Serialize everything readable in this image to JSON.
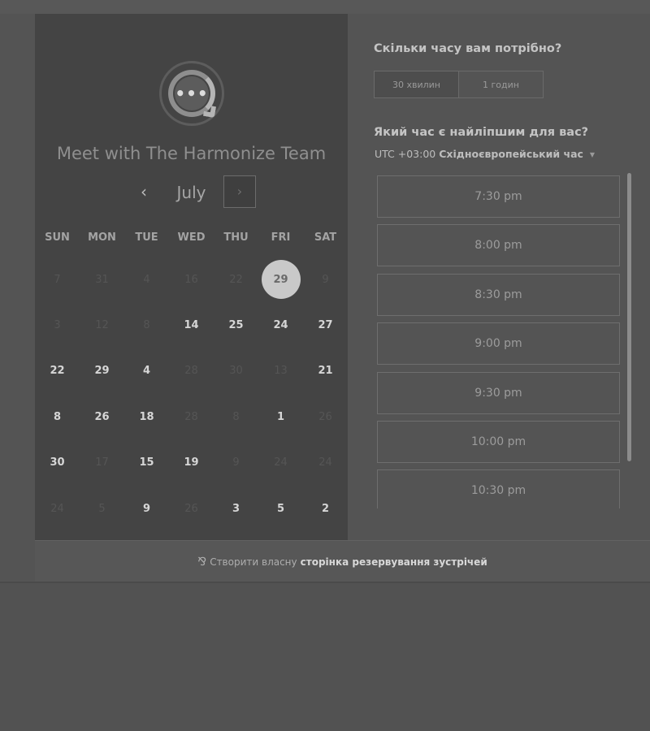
{
  "calendar": {
    "meeting_title": "Meet with The Harmonize Team",
    "logo_glyph": "•••",
    "month": "July",
    "prev_glyph": "‹",
    "next_glyph": "›",
    "weekdays": [
      "SUN",
      "MON",
      "TUE",
      "WED",
      "THU",
      "FRI",
      "SAT"
    ],
    "weeks": [
      [
        {
          "d": "7",
          "a": false
        },
        {
          "d": "31",
          "a": false
        },
        {
          "d": "4",
          "a": false
        },
        {
          "d": "16",
          "a": false
        },
        {
          "d": "22",
          "a": false
        },
        {
          "d": "29",
          "a": true,
          "selected": true
        },
        {
          "d": "9",
          "a": false
        }
      ],
      [
        {
          "d": "3",
          "a": false
        },
        {
          "d": "12",
          "a": false
        },
        {
          "d": "8",
          "a": false
        },
        {
          "d": "14",
          "a": true
        },
        {
          "d": "25",
          "a": true
        },
        {
          "d": "24",
          "a": true
        },
        {
          "d": "27",
          "a": true
        }
      ],
      [
        {
          "d": "22",
          "a": true
        },
        {
          "d": "29",
          "a": true
        },
        {
          "d": "4",
          "a": true
        },
        {
          "d": "28",
          "a": false
        },
        {
          "d": "30",
          "a": false
        },
        {
          "d": "13",
          "a": false
        },
        {
          "d": "21",
          "a": true
        }
      ],
      [
        {
          "d": "8",
          "a": true
        },
        {
          "d": "26",
          "a": true
        },
        {
          "d": "18",
          "a": true
        },
        {
          "d": "28",
          "a": false
        },
        {
          "d": "8",
          "a": false
        },
        {
          "d": "1",
          "a": true
        },
        {
          "d": "26",
          "a": false
        }
      ],
      [
        {
          "d": "30",
          "a": true
        },
        {
          "d": "17",
          "a": false
        },
        {
          "d": "15",
          "a": true
        },
        {
          "d": "19",
          "a": true
        },
        {
          "d": "9",
          "a": false
        },
        {
          "d": "24",
          "a": false
        },
        {
          "d": "24",
          "a": false
        }
      ],
      [
        {
          "d": "24",
          "a": false
        },
        {
          "d": "5",
          "a": false
        },
        {
          "d": "9",
          "a": true
        },
        {
          "d": "26",
          "a": false
        },
        {
          "d": "3",
          "a": true
        },
        {
          "d": "5",
          "a": true
        },
        {
          "d": "2",
          "a": true
        }
      ]
    ]
  },
  "booking": {
    "duration_question": "Скільки часу вам потрібно?",
    "durations": [
      "30 хвилин",
      "1 годин"
    ],
    "time_question": "Який час є найліпшим для вас?",
    "timezone_offset": "UTC +03:00",
    "timezone_name": "Східноєвропейський час",
    "timezone_caret": "▼",
    "slots": [
      "7:30 pm",
      "8:00 pm",
      "8:30 pm",
      "9:00 pm",
      "9:30 pm",
      "10:00 pm",
      "10:30 pm"
    ]
  },
  "footer": {
    "icon": "⅋",
    "text": "Створити власну",
    "link": "сторінка резервування зустрічей"
  }
}
